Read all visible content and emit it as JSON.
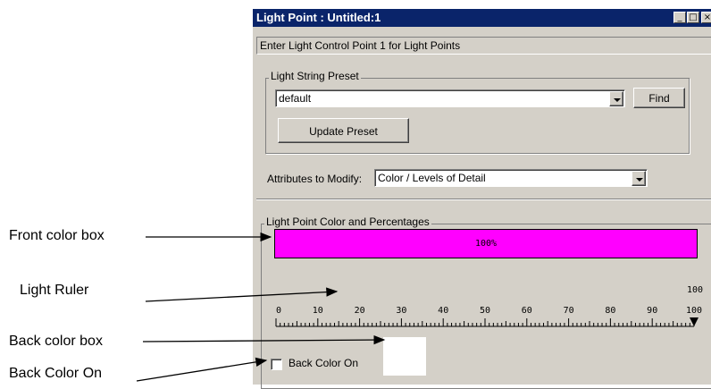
{
  "callouts": {
    "front_color_box": "Front color box",
    "light_ruler": "Light Ruler",
    "back_color_box": "Back color box",
    "back_color_on": "Back Color On"
  },
  "window": {
    "title": "Light Point : Untitled:1",
    "instruction": "Enter Light Control Point 1 for  Light Points"
  },
  "preset_group": {
    "legend": "Light String Preset",
    "selected": "default",
    "find_label": "Find",
    "update_label": "Update Preset"
  },
  "attributes": {
    "label": "Attributes to Modify:",
    "selected": "Color / Levels of Detail"
  },
  "color_group": {
    "legend": "Light Point Color and Percentages",
    "front_percent": "100%",
    "front_color": "#ff00ff",
    "back_color": "#ffffff",
    "back_color_on_label": "Back Color On",
    "back_color_on_checked": false
  },
  "ruler": {
    "labels": [
      "0",
      "10",
      "20",
      "30",
      "40",
      "50",
      "60",
      "70",
      "80",
      "90",
      "100"
    ],
    "top_label": "100",
    "marker_value": 100
  }
}
